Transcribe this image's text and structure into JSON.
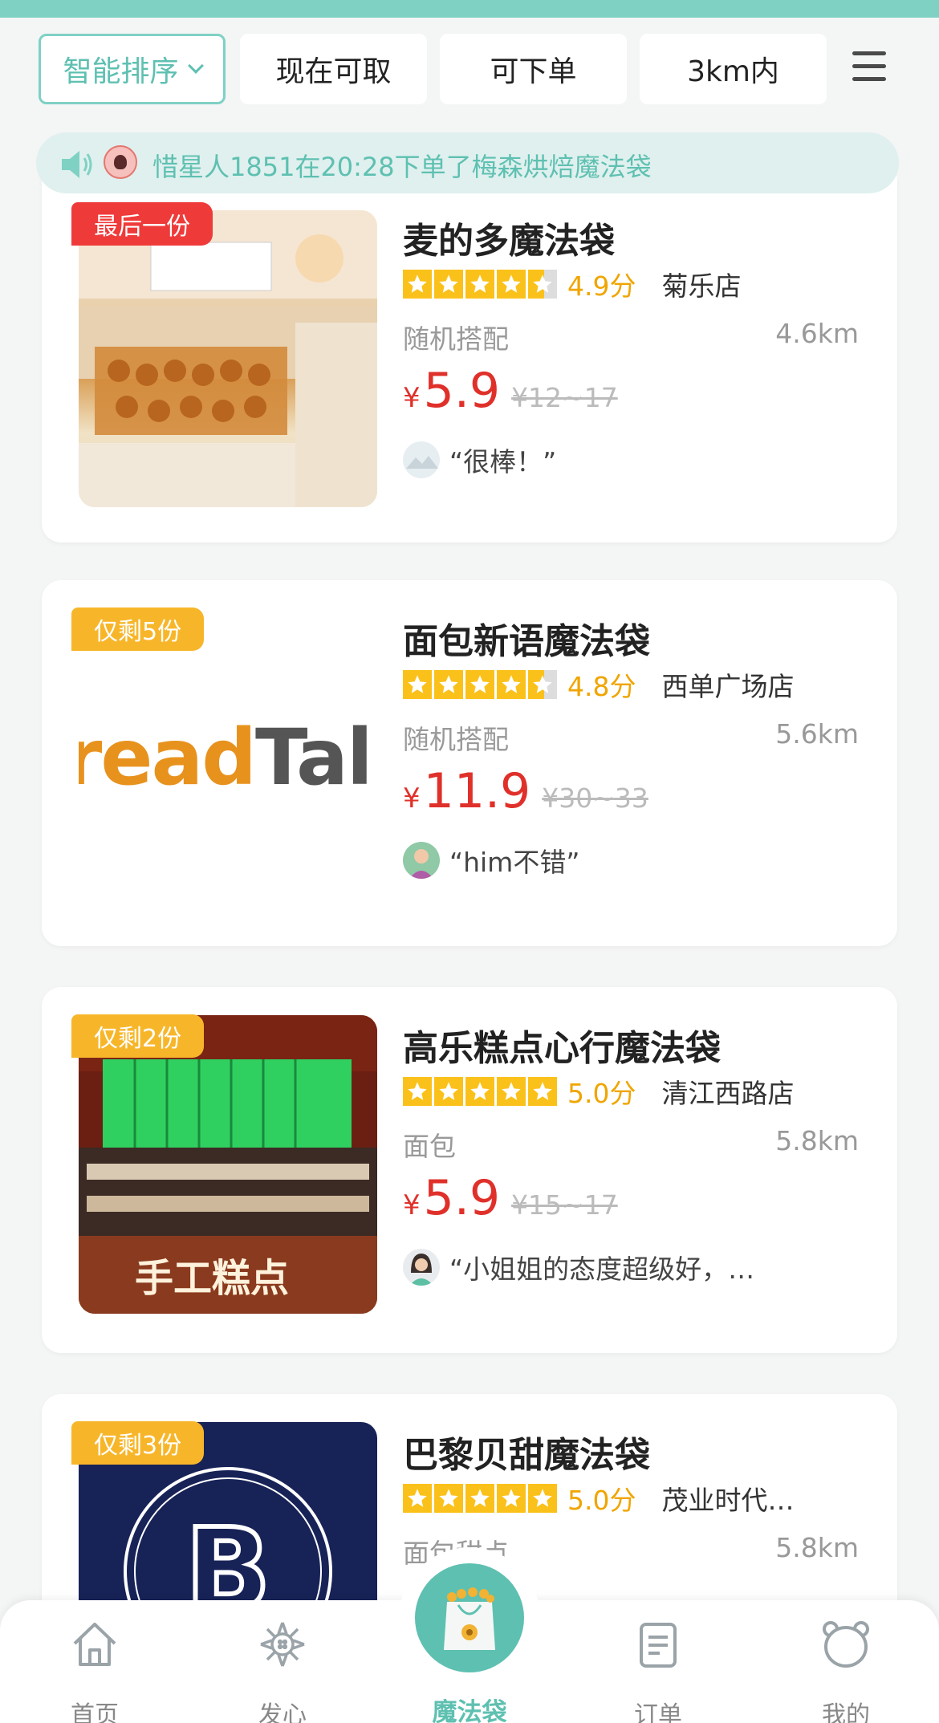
{
  "filters": {
    "sort_label": "智能排序",
    "now_label": "现在可取",
    "order_label": "可下单",
    "distance_label": "3km内"
  },
  "notice": {
    "text": "惜星人1851在20:28下单了梅森烘焙魔法袋"
  },
  "cards": [
    {
      "badge": "最后一份",
      "name": "麦的多魔法袋",
      "rating": 4.9,
      "score": "4.9分",
      "store": "菊乐店",
      "category": "随机搭配",
      "distance": "4.6km",
      "currency": "¥",
      "price": "5.9",
      "original_price": "¥12~17",
      "review": "“很棒！”"
    },
    {
      "badge": "仅剩5份",
      "name": "面包新语魔法袋",
      "rating": 4.8,
      "score": "4.8分",
      "store": "西单广场店",
      "category": "随机搭配",
      "distance": "5.6km",
      "currency": "¥",
      "price": "11.9",
      "original_price": "¥30~33",
      "review": "“him不错”",
      "logo_text": "readTall"
    },
    {
      "badge": "仅剩2份",
      "name": "高乐糕点心行魔法袋",
      "rating": 5.0,
      "score": "5.0分",
      "store": "清江西路店",
      "category": "面包",
      "distance": "5.8km",
      "currency": "¥",
      "price": "5.9",
      "original_price": "¥15~17",
      "review": "“小姐姐的态度超级好，…",
      "sign_text": "手工糕点"
    },
    {
      "badge": "仅剩3份",
      "name": "巴黎贝甜魔法袋",
      "rating": 5.0,
      "score": "5.0分",
      "store": "茂业时代…",
      "category": "面包甜点",
      "distance": "5.8km"
    }
  ],
  "nav": {
    "home": "首页",
    "heart": "发心",
    "magic_bag": "魔法袋",
    "orders": "订单",
    "mine": "我的"
  }
}
